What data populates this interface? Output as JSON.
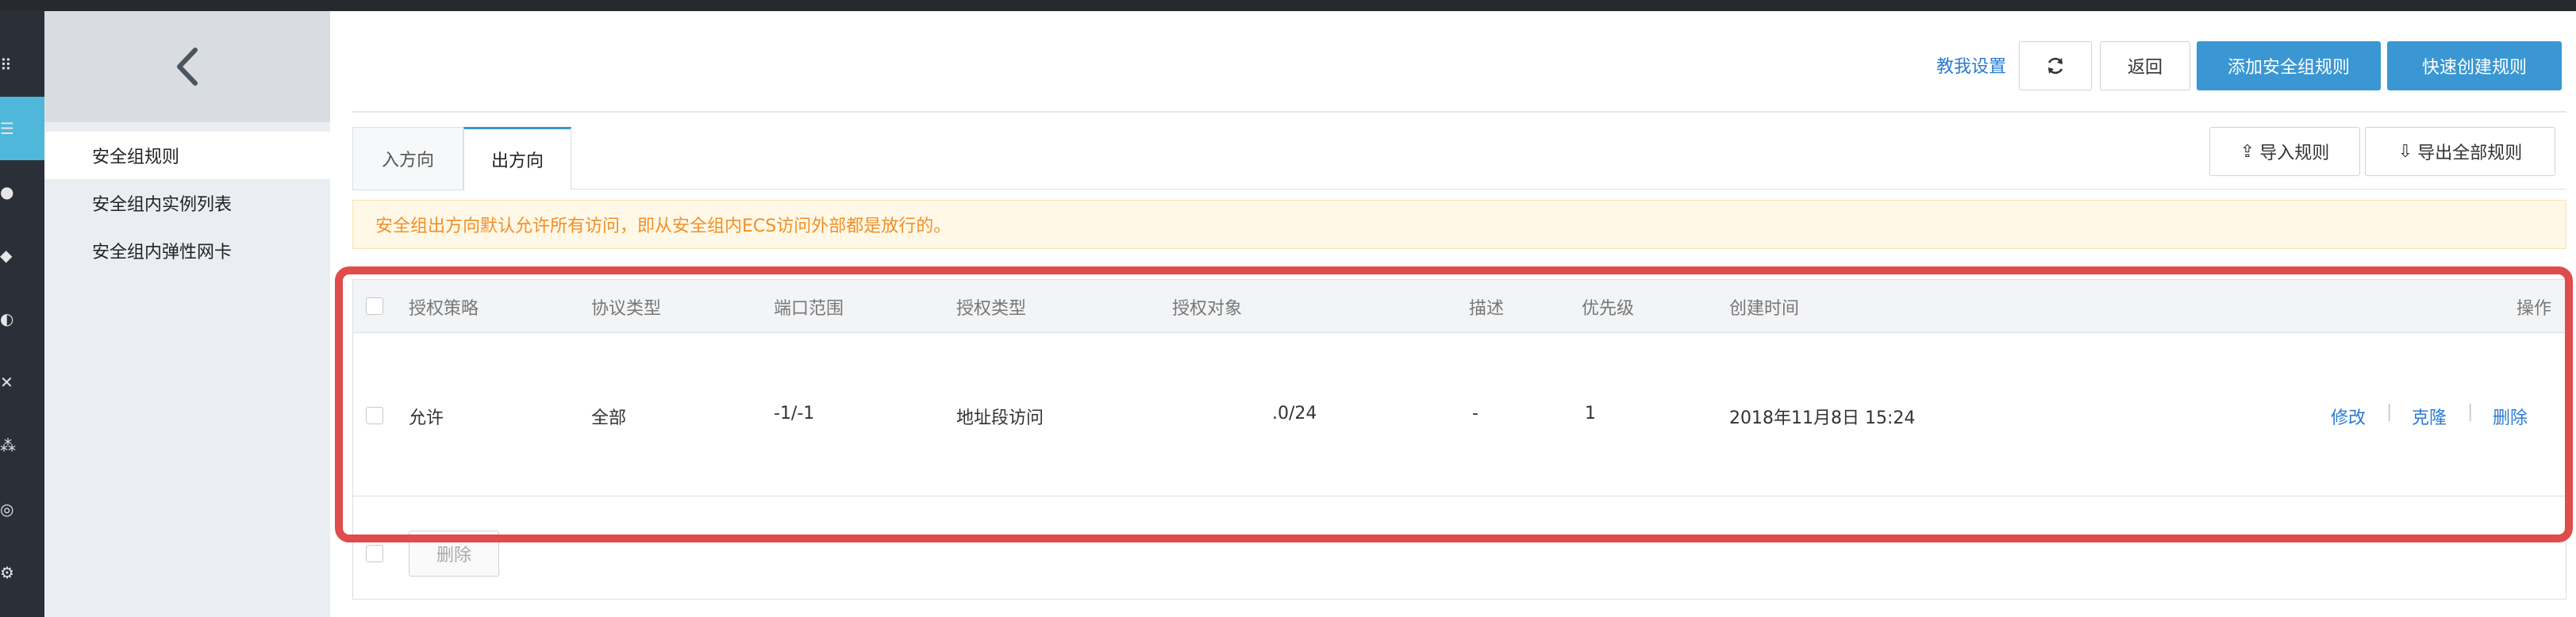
{
  "sidebar": {
    "items": [
      {
        "label": "安全组规则"
      },
      {
        "label": "安全组内实例列表"
      },
      {
        "label": "安全组内弹性网卡"
      }
    ]
  },
  "header": {
    "help_link": "教我设置",
    "back_button": "返回",
    "add_rule_button": "添加安全组规则",
    "quick_create_button": "快速创建规则"
  },
  "tabs": [
    {
      "label": "入方向"
    },
    {
      "label": "出方向"
    }
  ],
  "toolbar": {
    "import_button": "导入规则",
    "export_button": "导出全部规则"
  },
  "notice": "安全组出方向默认允许所有访问，即从安全组内ECS访问外部都是放行的。",
  "table": {
    "columns": [
      "授权策略",
      "协议类型",
      "端口范围",
      "授权类型",
      "授权对象",
      "描述",
      "优先级",
      "创建时间",
      "操作"
    ],
    "rows": [
      {
        "policy": "允许",
        "protocol": "全部",
        "port_range": "-1/-1",
        "auth_type": "地址段访问",
        "auth_object": ".0/24",
        "description": "-",
        "priority": "1",
        "created": "2018年11月8日 15:24",
        "actions": [
          "修改",
          "克隆",
          "删除"
        ]
      }
    ]
  },
  "footer": {
    "delete_button": "删除"
  },
  "colors": {
    "accent": "#3a97d3",
    "rail_active": "#4fb7d9",
    "highlight": "#e04b4b",
    "notice_text": "#f0902a"
  }
}
